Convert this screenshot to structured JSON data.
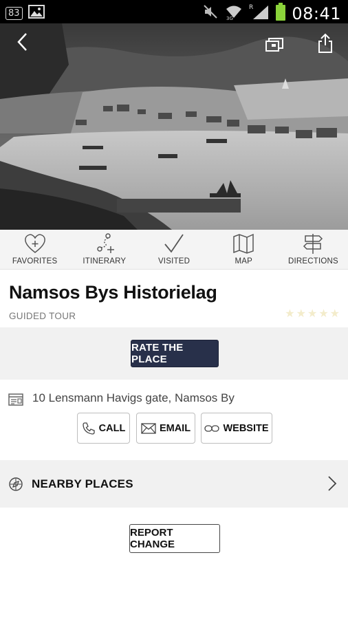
{
  "status_bar": {
    "notification_badge": "83",
    "time": "08:41",
    "roaming": "R"
  },
  "actions": [
    {
      "label": "FAVORITES",
      "icon": "heart-plus-icon"
    },
    {
      "label": "ITINERARY",
      "icon": "route-plus-icon"
    },
    {
      "label": "VISITED",
      "icon": "checkmark-icon"
    },
    {
      "label": "MAP",
      "icon": "map-icon"
    },
    {
      "label": "DIRECTIONS",
      "icon": "signpost-icon"
    }
  ],
  "place": {
    "title": "Namsos Bys Historielag",
    "category": "GUIDED TOUR",
    "rating": 0,
    "rating_max": 5
  },
  "rate_button": "RATE THE PLACE",
  "address": "10 Lensmann Havigs gate, Namsos By",
  "contact": {
    "call": "CALL",
    "email": "EMAIL",
    "website": "WEBSITE"
  },
  "nearby_label": "NEARBY PLACES",
  "report_button": "REPORT CHANGE",
  "colors": {
    "status_bar": "#000000",
    "rate_button": "#28304a",
    "panel_gray": "#f1f1f1",
    "star_empty": "#f3eccb"
  }
}
